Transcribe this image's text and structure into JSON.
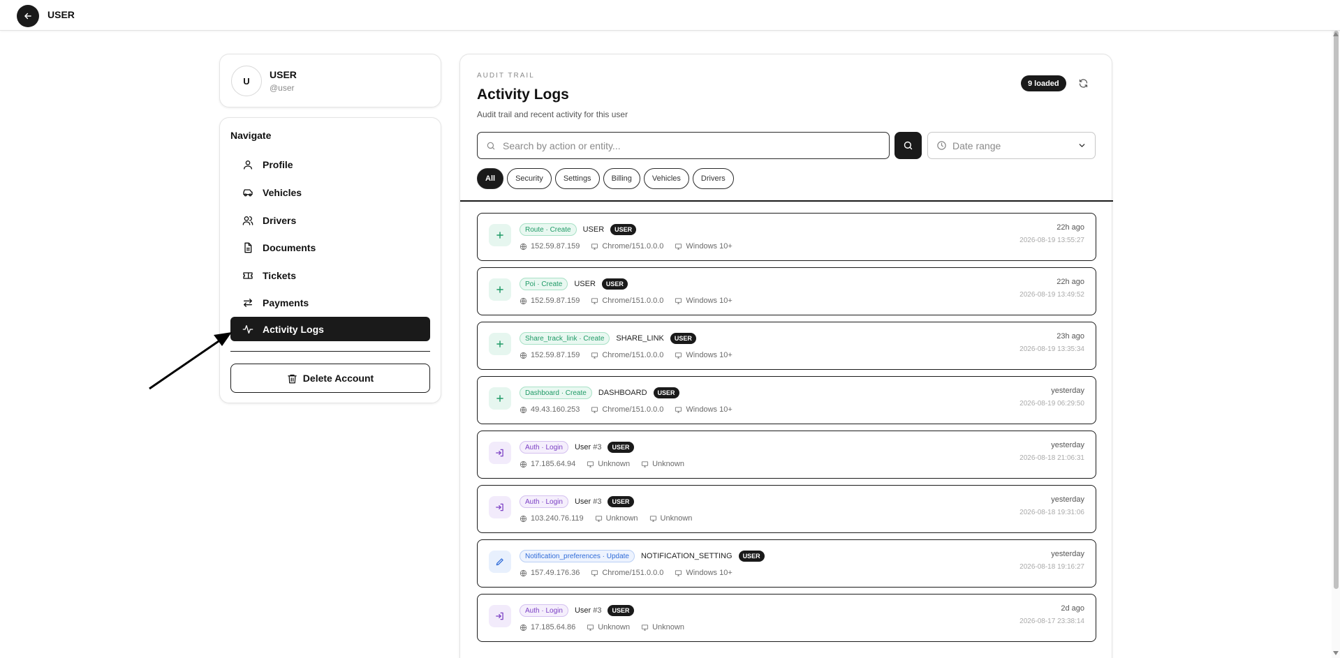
{
  "header": {
    "title": "USER"
  },
  "user": {
    "initial": "U",
    "name": "USER",
    "handle": "@user"
  },
  "nav": {
    "title": "Navigate",
    "items": [
      {
        "label": "Profile",
        "icon": "user-icon"
      },
      {
        "label": "Vehicles",
        "icon": "car-icon"
      },
      {
        "label": "Drivers",
        "icon": "users-icon"
      },
      {
        "label": "Documents",
        "icon": "document-icon"
      },
      {
        "label": "Tickets",
        "icon": "ticket-icon"
      },
      {
        "label": "Payments",
        "icon": "transfer-icon"
      },
      {
        "label": "Activity Logs",
        "icon": "activity-icon",
        "active": true
      }
    ],
    "delete_label": "Delete Account"
  },
  "main": {
    "eyebrow": "AUDIT TRAIL",
    "title": "Activity Logs",
    "subtitle": "Audit trail and recent activity for this user",
    "loaded_badge": "9 loaded",
    "search_placeholder": "Search by action or entity...",
    "date_range_label": "Date range",
    "filters": [
      "All",
      "Security",
      "Settings",
      "Billing",
      "Vehicles",
      "Drivers"
    ],
    "active_filter": "All"
  },
  "logs": [
    {
      "tone": "create",
      "action": "Route · Create",
      "entity": "USER",
      "entity_num": "",
      "role": "USER",
      "ip": "152.59.87.159",
      "browser": "Chrome/151.0.0.0",
      "os": "Windows 10+",
      "relative": "22h ago",
      "timestamp": "2026-08-19 13:55:27"
    },
    {
      "tone": "create",
      "action": "Poi · Create",
      "entity": "USER",
      "entity_num": "",
      "role": "USER",
      "ip": "152.59.87.159",
      "browser": "Chrome/151.0.0.0",
      "os": "Windows 10+",
      "relative": "22h ago",
      "timestamp": "2026-08-19 13:49:52"
    },
    {
      "tone": "create",
      "action": "Share_track_link · Create",
      "entity": "SHARE_LINK",
      "entity_num": "",
      "role": "USER",
      "ip": "152.59.87.159",
      "browser": "Chrome/151.0.0.0",
      "os": "Windows 10+",
      "relative": "23h ago",
      "timestamp": "2026-08-19 13:35:34"
    },
    {
      "tone": "create",
      "action": "Dashboard · Create",
      "entity": "DASHBOARD",
      "entity_num": "",
      "role": "USER",
      "ip": "49.43.160.253",
      "browser": "Chrome/151.0.0.0",
      "os": "Windows 10+",
      "relative": "yesterday",
      "timestamp": "2026-08-19 06:29:50"
    },
    {
      "tone": "login",
      "action": "Auth · Login",
      "entity": "User",
      "entity_num": "#3",
      "role": "USER",
      "ip": "17.185.64.94",
      "browser": "Unknown",
      "os": "Unknown",
      "relative": "yesterday",
      "timestamp": "2026-08-18 21:06:31"
    },
    {
      "tone": "login",
      "action": "Auth · Login",
      "entity": "User",
      "entity_num": "#3",
      "role": "USER",
      "ip": "103.240.76.119",
      "browser": "Unknown",
      "os": "Unknown",
      "relative": "yesterday",
      "timestamp": "2026-08-18 19:31:06"
    },
    {
      "tone": "update",
      "action": "Notification_preferences · Update",
      "entity": "NOTIFICATION_SETTING",
      "entity_num": "",
      "role": "USER",
      "ip": "157.49.176.36",
      "browser": "Chrome/151.0.0.0",
      "os": "Windows 10+",
      "relative": "yesterday",
      "timestamp": "2026-08-18 19:16:27"
    },
    {
      "tone": "login",
      "action": "Auth · Login",
      "entity": "User",
      "entity_num": "#3",
      "role": "USER",
      "ip": "17.185.64.86",
      "browser": "Unknown",
      "os": "Unknown",
      "relative": "2d ago",
      "timestamp": "2026-08-17 23:38:14"
    }
  ]
}
